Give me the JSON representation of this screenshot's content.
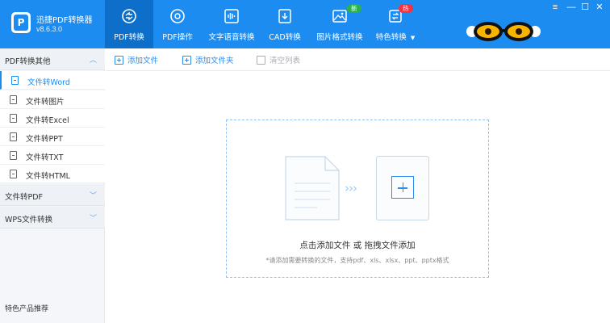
{
  "app": {
    "name": "迅捷PDF转换器",
    "version": "v8.6.3.0"
  },
  "nav": [
    {
      "label": "PDF转换",
      "icon": "pdf-convert-icon",
      "active": true
    },
    {
      "label": "PDF操作",
      "icon": "pdf-operate-icon"
    },
    {
      "label": "文字语音转换",
      "icon": "audio-icon"
    },
    {
      "label": "CAD转换",
      "icon": "cad-icon"
    },
    {
      "label": "图片格式转换",
      "icon": "image-icon",
      "badge": "新"
    },
    {
      "label": "特色转换",
      "icon": "special-icon",
      "badge": "热",
      "dropdown": "▼"
    }
  ],
  "window_controls": {
    "menu": "≡",
    "minimize": "—",
    "maximize": "☐",
    "close": "✕"
  },
  "sidebar": {
    "group1": {
      "label": "PDF转换其他",
      "chevron": "︿"
    },
    "items": [
      {
        "label": "文件转Word",
        "active": true
      },
      {
        "label": "文件转图片"
      },
      {
        "label": "文件转Excel"
      },
      {
        "label": "文件转PPT"
      },
      {
        "label": "文件转TXT"
      },
      {
        "label": "文件转HTML"
      }
    ],
    "group2": {
      "label": "文件转PDF",
      "chevron": "﹀"
    },
    "group3": {
      "label": "WPS文件转换",
      "chevron": "﹀"
    },
    "footer": "特色产品推荐"
  },
  "toolbar": {
    "add_file": "添加文件",
    "add_folder": "添加文件夹",
    "clear_list": "清空列表"
  },
  "dropzone": {
    "arrows": "›››",
    "main_text": "点击添加文件 或 拖拽文件添加",
    "hint_text": "*请添加需要转换的文件，支持pdf、xls、xlsx、ppt、pptx格式"
  },
  "colors": {
    "header": "#1d8cf0",
    "nav_active": "#0e6fcb",
    "accent": "#2d8cf0",
    "badge_new": "#2bb24c",
    "badge_hot": "#f5333f"
  }
}
